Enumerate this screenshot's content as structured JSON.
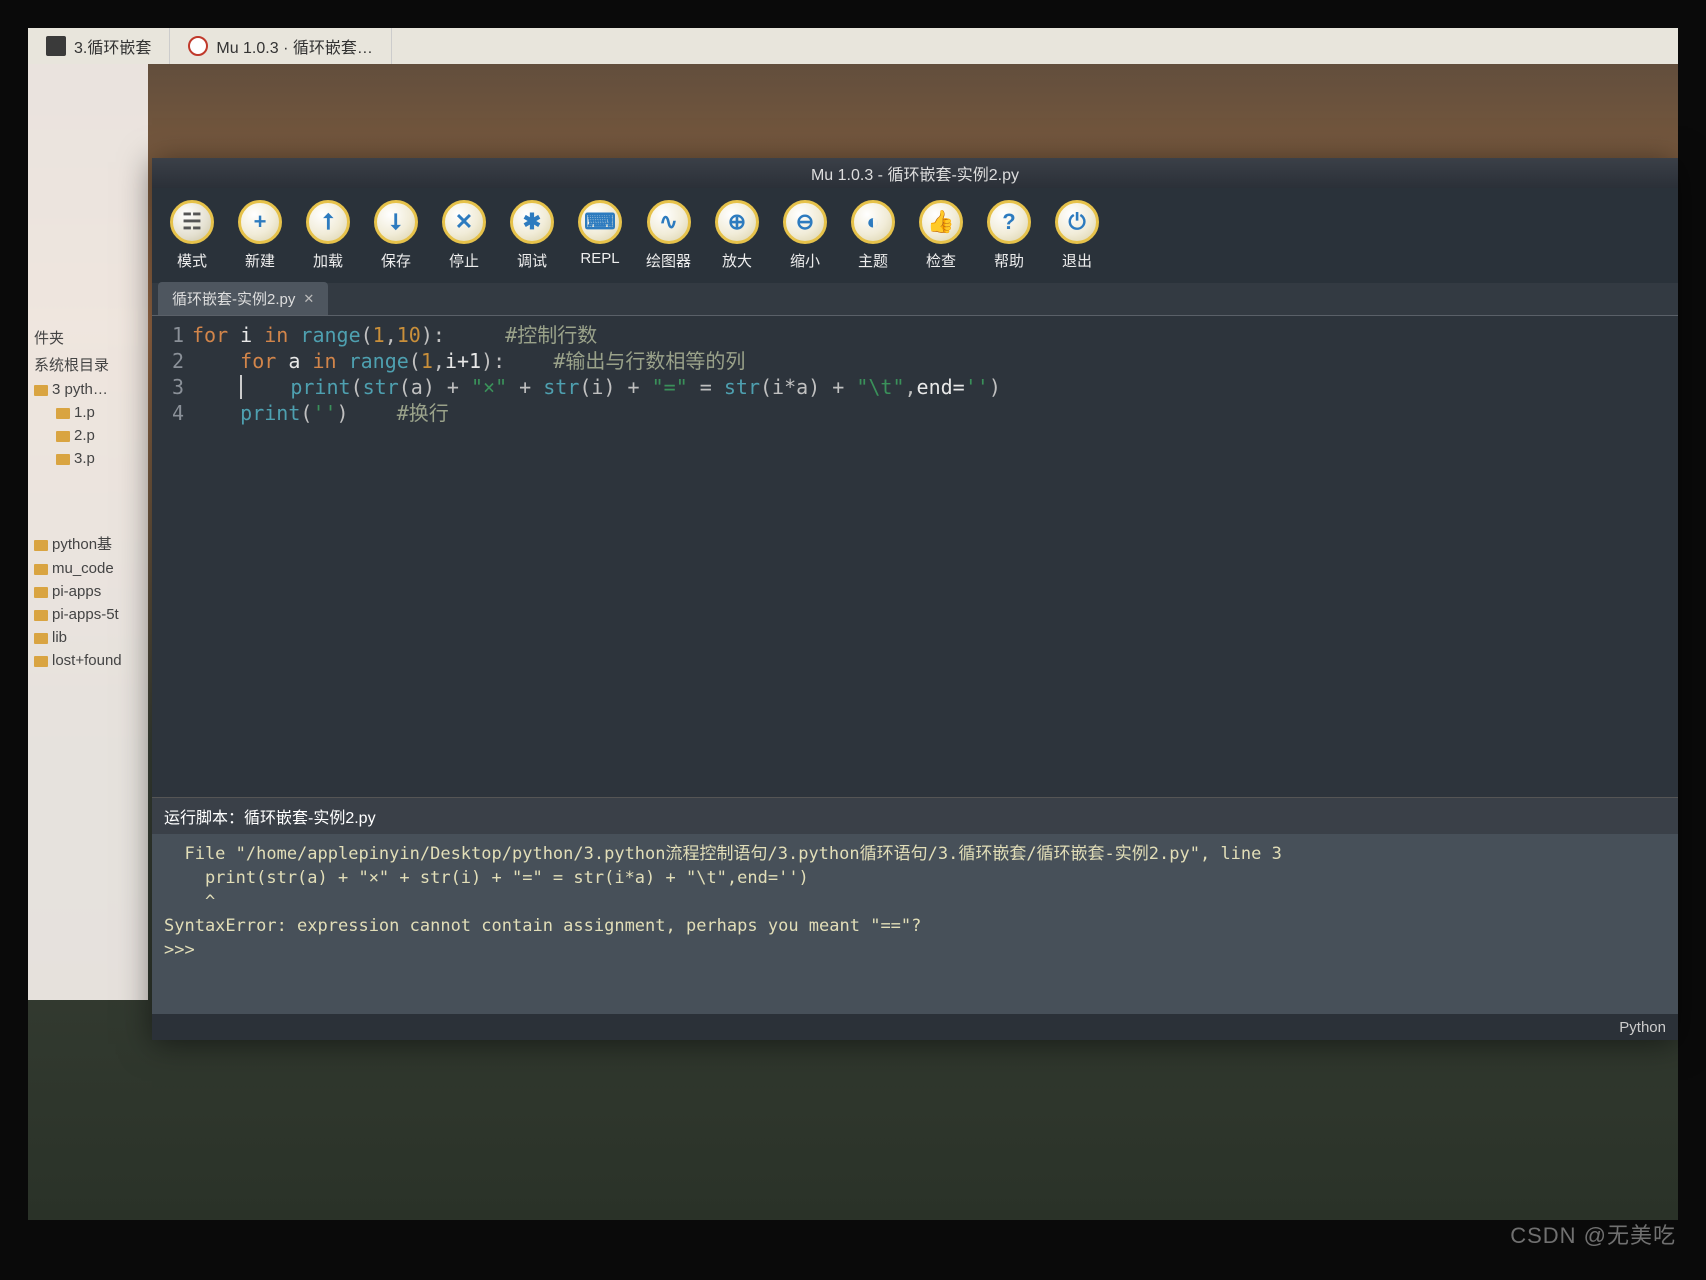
{
  "taskbar": {
    "items": [
      "3.循环嵌套",
      "Mu 1.0.3 · 循环嵌套…"
    ]
  },
  "mu": {
    "title": "Mu 1.0.3 - 循环嵌套-实例2.py",
    "toolbar": [
      {
        "label": "模式",
        "glyph": "☵"
      },
      {
        "label": "新建",
        "glyph": "+"
      },
      {
        "label": "加载",
        "glyph": "⭡"
      },
      {
        "label": "保存",
        "glyph": "⭣"
      },
      {
        "label": "停止",
        "glyph": "✕"
      },
      {
        "label": "调试",
        "glyph": "✱"
      },
      {
        "label": "REPL",
        "glyph": "⌨"
      },
      {
        "label": "绘图器",
        "glyph": "∿"
      },
      {
        "label": "放大",
        "glyph": "⊕"
      },
      {
        "label": "缩小",
        "glyph": "⊖"
      },
      {
        "label": "主题",
        "glyph": "◐"
      },
      {
        "label": "检查",
        "glyph": "👍"
      },
      {
        "label": "帮助",
        "glyph": "?"
      },
      {
        "label": "退出",
        "glyph": "⏻"
      }
    ],
    "tab": "循环嵌套-实例2.py",
    "gutter": [
      "1",
      "2",
      "3",
      "4"
    ],
    "code": {
      "l1": {
        "for": "for",
        "i": "i",
        "in": "in",
        "range": "range",
        "open": "(",
        "n1": "1",
        "comma": ",",
        "n2": "10",
        "close": "):",
        "cmt": "#控制行数"
      },
      "l2": {
        "for": "for",
        "a": "a",
        "in": "in",
        "range": "range",
        "open": "(",
        "n1": "1",
        "comma": ",",
        "expr": "i+1",
        "close": "):",
        "cmt": "#输出与行数相等的列"
      },
      "l3": {
        "print": "print",
        "open": "(",
        "fn1": "str",
        "p1": "(a)",
        "plus1": " + ",
        "s1": "\"×\"",
        "plus2": " + ",
        "fn2": "str",
        "p2": "(i)",
        "plus3": " + ",
        "s2": "\"=\"",
        "eq": " = ",
        "fn3": "str",
        "p3": "(i*a)",
        "plus4": " + ",
        "s3": "\"\\t\"",
        "comma": ",",
        "kw": "end=",
        "s4": "''",
        "close": ")"
      },
      "l4": {
        "print": "print",
        "open": "(",
        "s": "''",
        "close": ")",
        "cmt": "#换行"
      }
    },
    "outputHead": "运行脚本：循环嵌套-实例2.py",
    "output": "  File \"/home/applepinyin/Desktop/python/3.python流程控制语句/3.python循环语句/3.循环嵌套/循环嵌套-实例2.py\", line 3\n    print(str(a) + \"×\" + str(i) + \"=\" = str(i*a) + \"\\t\",end='')\n    ^\nSyntaxError: expression cannot contain assignment, perhaps you meant \"==\"?\n>>> ",
    "statusbar": "Python"
  },
  "filepanel": {
    "head1": "件夹",
    "head2": "系统根目录",
    "items": [
      "3 pyth…",
      "1.p",
      "2.p",
      "3.p"
    ],
    "items2": [
      "python基",
      "mu_code",
      "pi-apps",
      "pi-apps-5t",
      "lib",
      "lost+found"
    ]
  },
  "watermark": "CSDN @无美吃"
}
